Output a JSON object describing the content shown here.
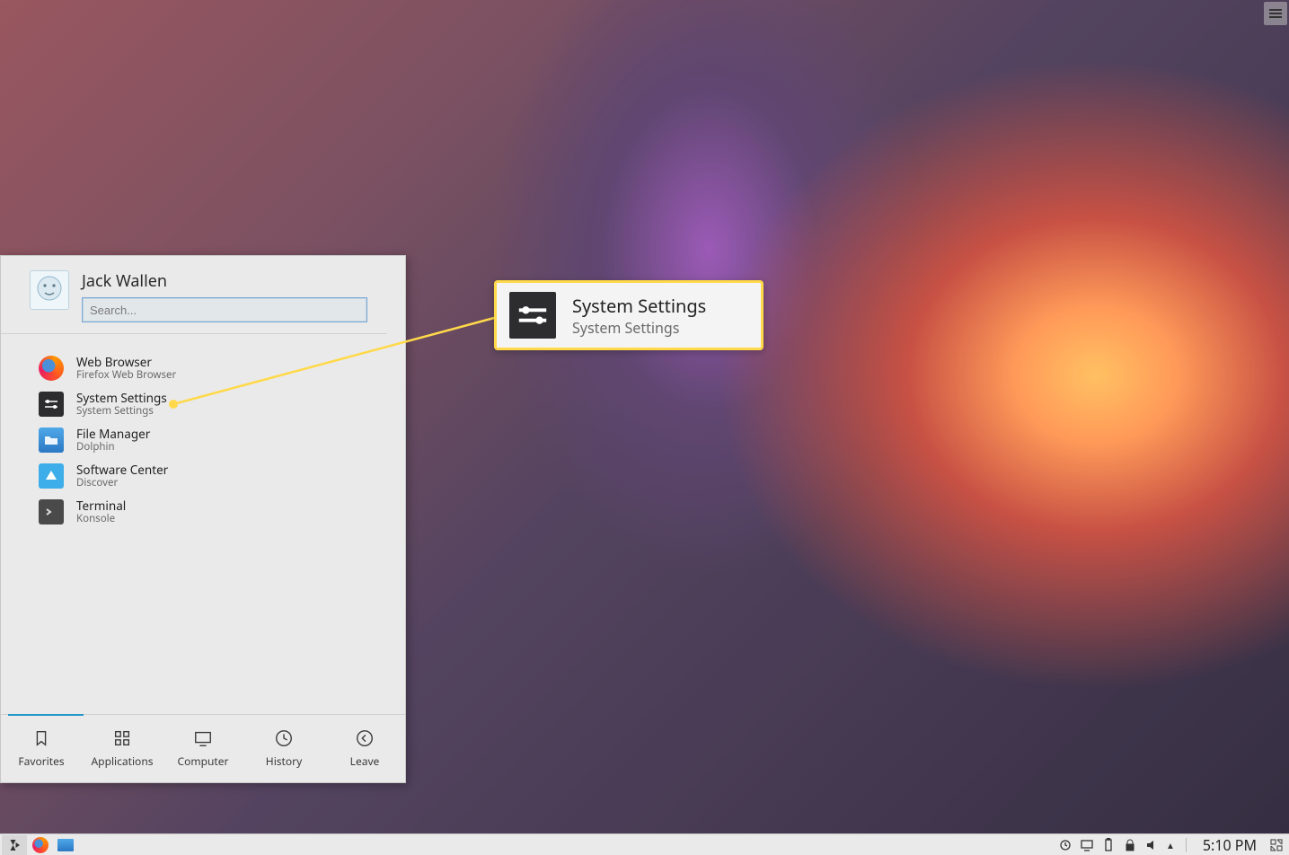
{
  "menu": {
    "username": "Jack Wallen",
    "search_placeholder": "Search...",
    "favorites": [
      {
        "label": "Web Browser",
        "sublabel": "Firefox Web Browser",
        "icon": "firefox"
      },
      {
        "label": "System Settings",
        "sublabel": "System Settings",
        "icon": "settings"
      },
      {
        "label": "File Manager",
        "sublabel": "Dolphin",
        "icon": "dolphin"
      },
      {
        "label": "Software Center",
        "sublabel": "Discover",
        "icon": "discover"
      },
      {
        "label": "Terminal",
        "sublabel": "Konsole",
        "icon": "terminal"
      }
    ],
    "tabs": {
      "active_index": 0,
      "items": [
        "Favorites",
        "Applications",
        "Computer",
        "History",
        "Leave"
      ]
    }
  },
  "callout": {
    "title": "System Settings",
    "subtitle": "System Settings"
  },
  "taskbar": {
    "clock": "5:10 PM"
  }
}
